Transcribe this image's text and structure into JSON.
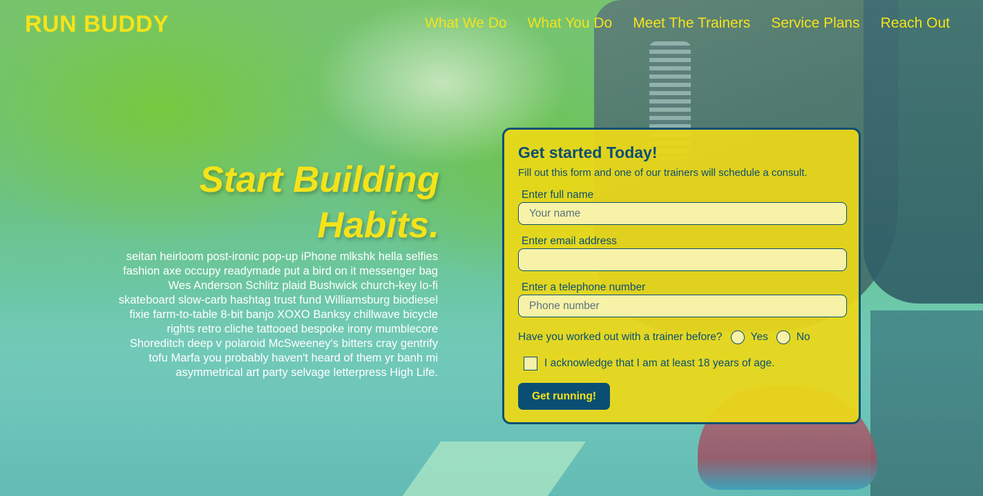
{
  "header": {
    "brand": "RUN BUDDY",
    "nav": [
      {
        "label": "What We Do"
      },
      {
        "label": "What You Do"
      },
      {
        "label": "Meet The Trainers"
      },
      {
        "label": "Service Plans"
      },
      {
        "label": "Reach Out"
      }
    ]
  },
  "hero": {
    "headline_line1": "Start Building",
    "headline_line2": "Habits.",
    "copy": "seitan heirloom post-ironic pop-up iPhone mlkshk hella selfies fashion axe occupy readymade put a bird on it messenger bag Wes Anderson Schlitz plaid Bushwick church-key lo-fi skateboard slow-carb hashtag trust fund Williamsburg biodiesel fixie farm-to-table 8-bit banjo XOXO Banksy chillwave bicycle rights retro cliche tattooed bespoke irony mumblecore Shoreditch deep v polaroid McSweeney's bitters cray gentrify tofu Marfa you probably haven't heard of them yr banh mi asymmetrical art party selvage letterpress High Life."
  },
  "form": {
    "title": "Get started Today!",
    "subtitle": "Fill out this form and one of our trainers will schedule a consult.",
    "name_label": "Enter full name",
    "name_placeholder": "Your name",
    "email_label": "Enter email address",
    "email_placeholder": "",
    "phone_label": "Enter a telephone number",
    "phone_placeholder": "Phone number",
    "trainer_question": "Have you worked out with a trainer before?",
    "yes_label": "Yes",
    "no_label": "No",
    "age_ack": "I acknowledge that I am at least 18 years of age.",
    "submit_label": "Get running!"
  },
  "colors": {
    "accent_yellow": "#f5e31a",
    "navy": "#0a4f73",
    "form_background": "#ecd818",
    "input_background": "#f8f2a8"
  }
}
